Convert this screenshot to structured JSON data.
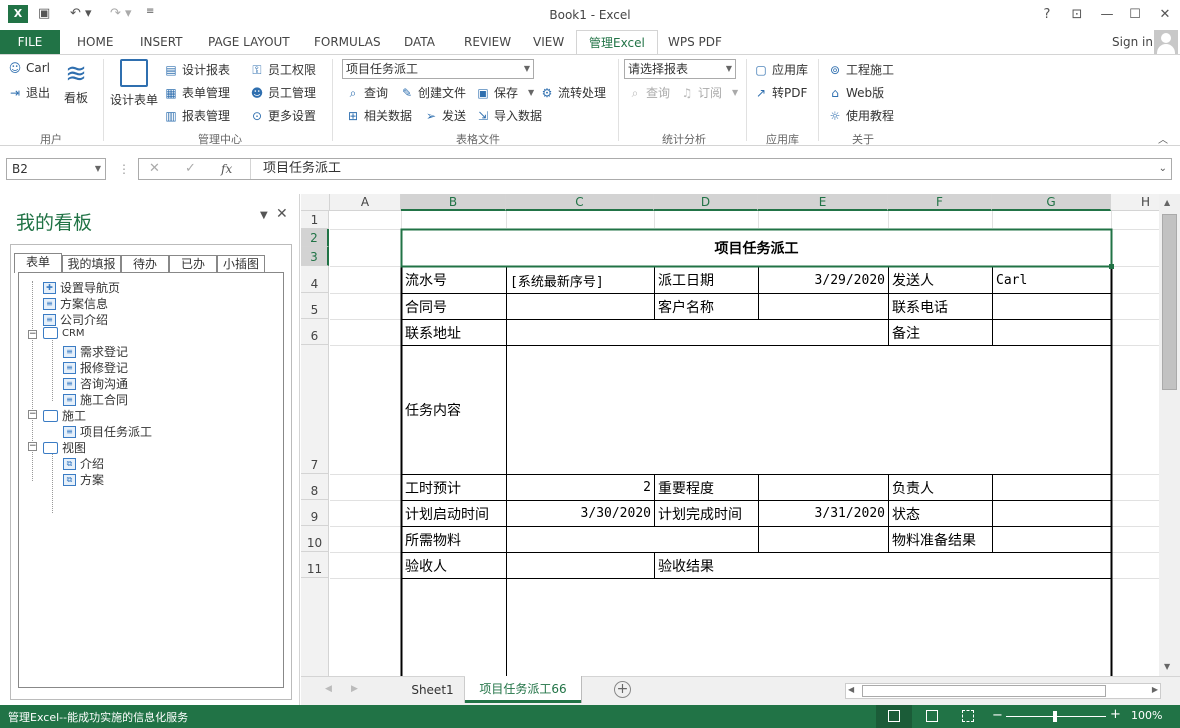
{
  "window": {
    "title": "Book1 - Excel",
    "app_icon": "excel-icon",
    "help": "?",
    "signin": "Sign in"
  },
  "tabs": [
    {
      "label": "FILE"
    },
    {
      "label": "HOME"
    },
    {
      "label": "INSERT"
    },
    {
      "label": "PAGE LAYOUT"
    },
    {
      "label": "FORMULAS"
    },
    {
      "label": "DATA"
    },
    {
      "label": "REVIEW"
    },
    {
      "label": "VIEW"
    },
    {
      "label": "管理Excel"
    },
    {
      "label": "WPS PDF"
    }
  ],
  "ribbon": {
    "user": {
      "carl": "Carl",
      "logout": "退出",
      "kanban": "看板",
      "group": "用户"
    },
    "manage": {
      "design_form": "设计表单",
      "design_report": "设计报表",
      "form_manage": "表单管理",
      "report_manage": "报表管理",
      "emp_perm": "员工权限",
      "emp_manage": "员工管理",
      "more_settings": "更多设置",
      "group": "管理中心"
    },
    "table_file": {
      "template_select": "项目任务派工",
      "query": "查询",
      "create_file": "创建文件",
      "save": "保存",
      "flow": "流转处理",
      "related": "相关数据",
      "send": "发送",
      "import": "导入数据",
      "group": "表格文件"
    },
    "stats": {
      "report_select": "请选择报表",
      "query": "查询",
      "subscribe": "订阅",
      "group": "统计分析"
    },
    "apps": {
      "app_store": "应用库",
      "to_pdf": "转PDF",
      "group": "应用库"
    },
    "about": {
      "construction": "工程施工",
      "web": "Web版",
      "tutorial": "使用教程",
      "group": "关于"
    }
  },
  "formula_bar": {
    "name_box": "B2",
    "fx": "fx",
    "content": "项目任务派工"
  },
  "panel": {
    "title": "我的看板",
    "tabs": [
      "表单",
      "我的填报",
      "待办",
      "已办",
      "小插图"
    ],
    "tree": [
      {
        "label": "设置导航页"
      },
      {
        "label": "方案信息"
      },
      {
        "label": "公司介绍"
      },
      {
        "label": "CRM"
      },
      {
        "label": "需求登记"
      },
      {
        "label": "报修登记"
      },
      {
        "label": "咨询沟通"
      },
      {
        "label": "施工合同"
      },
      {
        "label": "施工"
      },
      {
        "label": "项目任务派工"
      },
      {
        "label": "视图"
      },
      {
        "label": "介绍"
      },
      {
        "label": "方案"
      }
    ]
  },
  "sheet": {
    "columns": [
      "A",
      "B",
      "C",
      "D",
      "E",
      "F",
      "G",
      "H"
    ],
    "rows": [
      "1",
      "2",
      "3",
      "4",
      "5",
      "6",
      "7",
      "8",
      "9",
      "10",
      "11"
    ],
    "title": "项目任务派工",
    "cells": {
      "serial_label": "流水号",
      "serial_value": "[系统最新序号]",
      "dispatch_date_label": "派工日期",
      "dispatch_date_value": "3/29/2020",
      "sender_label": "发送人",
      "sender_value": "Carl",
      "contract_label": "合同号",
      "customer_label": "客户名称",
      "phone_label": "联系电话",
      "address_label": "联系地址",
      "remark_label": "备注",
      "task_label": "任务内容",
      "hours_label": "工时预计",
      "hours_value": "2",
      "priority_label": "重要程度",
      "owner_label": "负责人",
      "plan_start_label": "计划启动时间",
      "plan_start_value": "3/30/2020",
      "plan_end_label": "计划完成时间",
      "plan_end_value": "3/31/2020",
      "state_label": "状态",
      "materials_label": "所需物料",
      "materials_result_label": "物料准备结果",
      "acceptor_label": "验收人",
      "accept_result_label": "验收结果"
    }
  },
  "sheet_tabs": [
    "Sheet1",
    "项目任务派工66"
  ],
  "status": {
    "text": "管理Excel--能成功实施的信息化服务",
    "zoom": "100%"
  }
}
